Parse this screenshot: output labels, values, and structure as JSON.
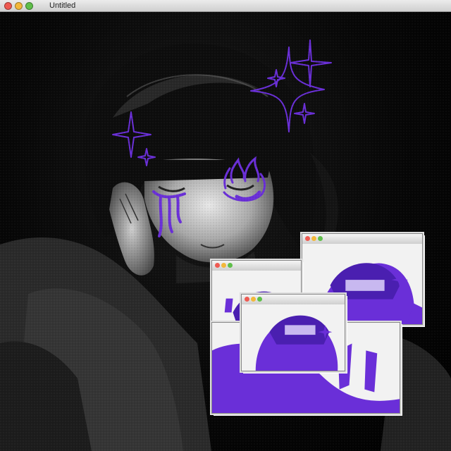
{
  "window": {
    "title": "Untitled",
    "controls": [
      {
        "name": "close",
        "color": "#ee5a52"
      },
      {
        "name": "minimize",
        "color": "#f3b83b"
      },
      {
        "name": "zoom",
        "color": "#5fbf4a"
      }
    ]
  },
  "accent_color": "#6a2fd8",
  "mini_windows": [
    {
      "name": "mini-window-back"
    },
    {
      "name": "mini-window-middle"
    },
    {
      "name": "mini-window-front"
    }
  ]
}
